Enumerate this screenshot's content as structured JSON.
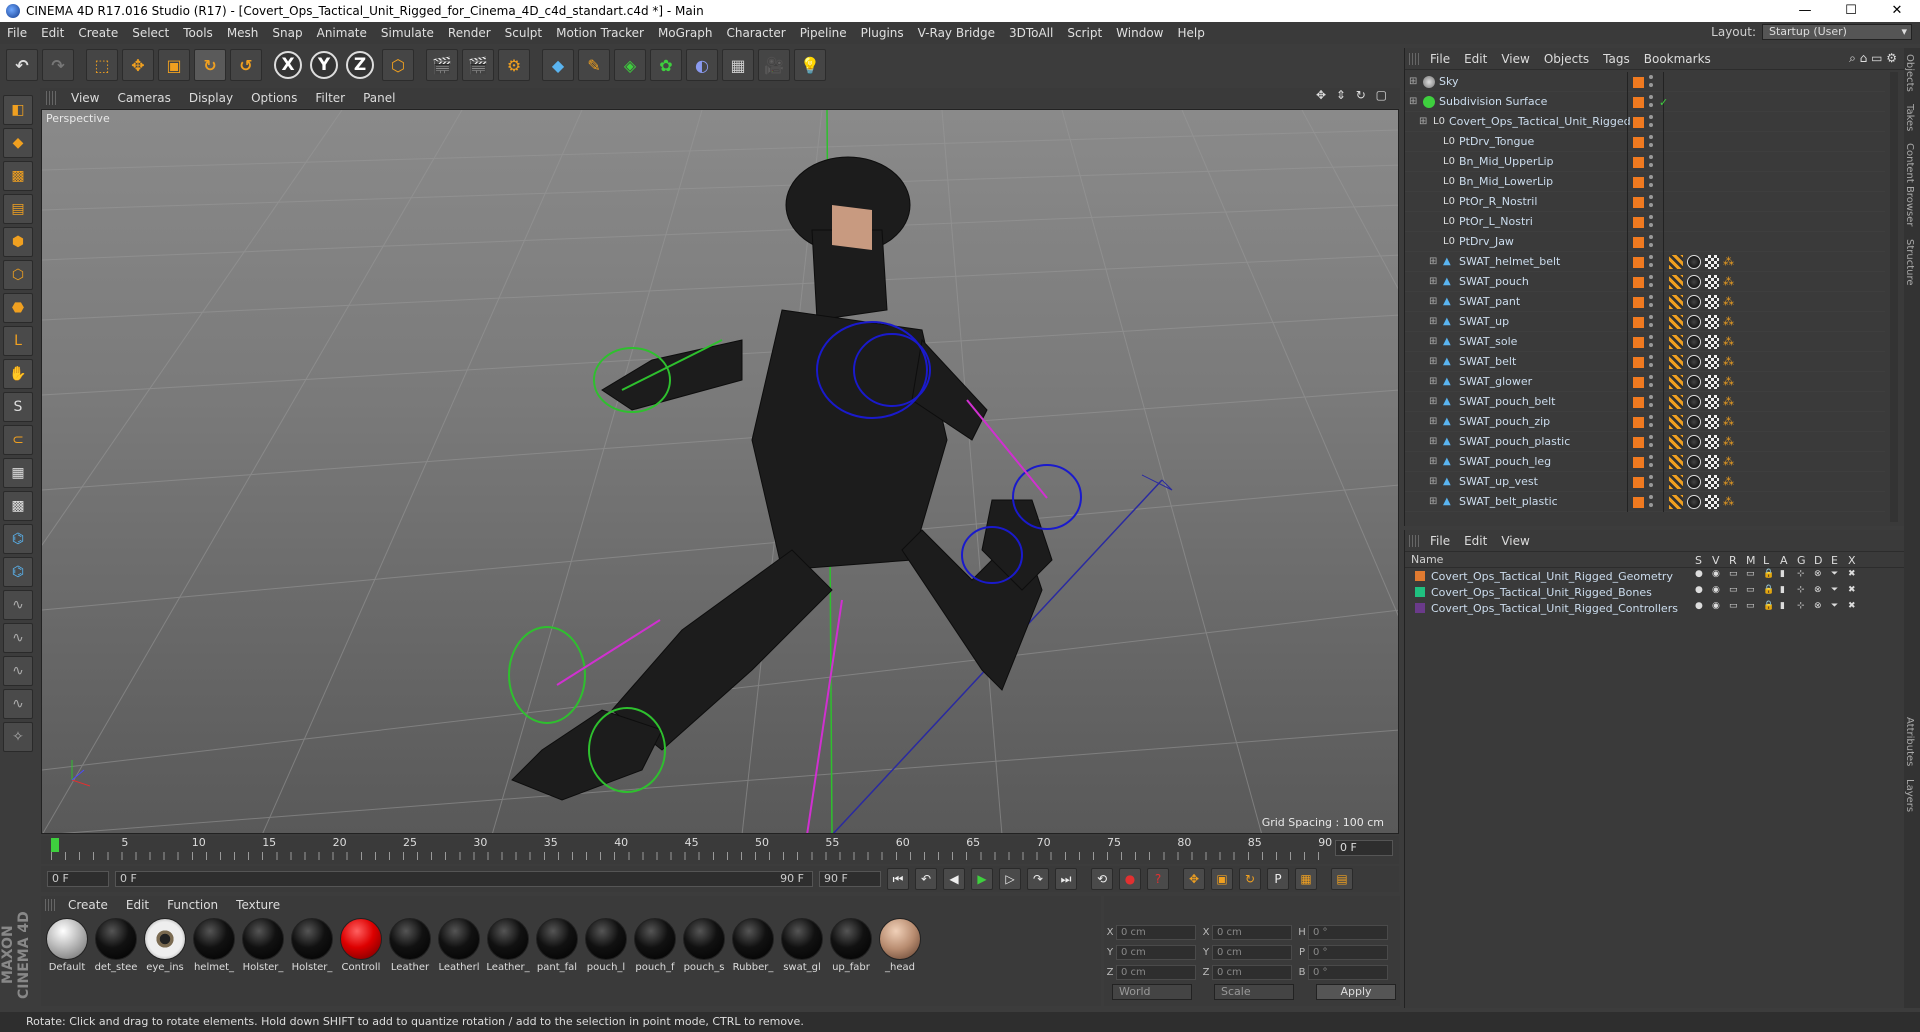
{
  "window": {
    "title": "CINEMA 4D R17.016 Studio (R17) - [Covert_Ops_Tactical_Unit_Rigged_for_Cinema_4D_c4d_standart.c4d *] - Main",
    "minimize": "—",
    "maximize": "☐",
    "close": "✕"
  },
  "menu": [
    "File",
    "Edit",
    "Create",
    "Select",
    "Tools",
    "Mesh",
    "Snap",
    "Animate",
    "Simulate",
    "Render",
    "Sculpt",
    "Motion Tracker",
    "MoGraph",
    "Character",
    "Pipeline",
    "Plugins",
    "V-Ray Bridge",
    "3DToAll",
    "Script",
    "Window",
    "Help"
  ],
  "layout": {
    "label": "Layout:",
    "value": "Startup (User)"
  },
  "toolbar": {
    "x_axis": "X",
    "y_axis": "Y",
    "z_axis": "Z"
  },
  "viewport": {
    "menu": [
      "View",
      "Cameras",
      "Display",
      "Options",
      "Filter",
      "Panel"
    ],
    "label": "Perspective",
    "grid_spacing": "Grid Spacing : 100 cm",
    "nav_icons": "✥ ⇕ ↻ ▢"
  },
  "timeline": {
    "ticks": [
      "0",
      "5",
      "10",
      "15",
      "20",
      "25",
      "30",
      "35",
      "40",
      "45",
      "50",
      "55",
      "60",
      "65",
      "70",
      "75",
      "80",
      "85",
      "90"
    ],
    "current": "0 F",
    "end": "0 F"
  },
  "transport": {
    "start_field": "0 F",
    "range_start": "0 F",
    "range_end": "90 F",
    "end_field": "90 F"
  },
  "materials": {
    "menu": [
      "Create",
      "Edit",
      "Function",
      "Texture"
    ],
    "items": [
      {
        "name": "Default",
        "kind": "default"
      },
      {
        "name": "det_stee",
        "kind": "black"
      },
      {
        "name": "eye_ins",
        "kind": "eye"
      },
      {
        "name": "helmet_",
        "kind": "black"
      },
      {
        "name": "Holster_",
        "kind": "black"
      },
      {
        "name": "Holster_",
        "kind": "black"
      },
      {
        "name": "Controll",
        "kind": "red"
      },
      {
        "name": "Leather",
        "kind": "black"
      },
      {
        "name": "Leatherl",
        "kind": "black"
      },
      {
        "name": "Leather_",
        "kind": "black"
      },
      {
        "name": "pant_fal",
        "kind": "black"
      },
      {
        "name": "pouch_l",
        "kind": "black"
      },
      {
        "name": "pouch_f",
        "kind": "black"
      },
      {
        "name": "pouch_s",
        "kind": "black"
      },
      {
        "name": "Rubber_",
        "kind": "black"
      },
      {
        "name": "swat_gl",
        "kind": "black"
      },
      {
        "name": "up_fabr",
        "kind": "black"
      },
      {
        "name": "_head",
        "kind": "skin"
      }
    ]
  },
  "coords": {
    "rows": [
      {
        "l1": "X",
        "v1": "0 cm",
        "l2": "X",
        "v2": "0 cm",
        "l3": "H",
        "v3": "0 °"
      },
      {
        "l1": "Y",
        "v1": "0 cm",
        "l2": "Y",
        "v2": "0 cm",
        "l3": "P",
        "v3": "0 °"
      },
      {
        "l1": "Z",
        "v1": "0 cm",
        "l2": "Z",
        "v2": "0 cm",
        "l3": "B",
        "v3": "0 °"
      }
    ],
    "space": "World",
    "mode": "Scale",
    "apply": "Apply"
  },
  "status": "Rotate: Click and drag to rotate elements. Hold down SHIFT to add to quantize rotation / add to the selection in point mode, CTRL to remove.",
  "maxon": "MAXON CINEMA 4D",
  "objects": {
    "menu": [
      "File",
      "Edit",
      "View",
      "Objects",
      "Tags",
      "Bookmarks"
    ],
    "rows": [
      {
        "name": "Sky",
        "indent": 0,
        "icon": "sky",
        "tags": false
      },
      {
        "name": "Subdivision Surface",
        "indent": 0,
        "icon": "subd",
        "tags": false
      },
      {
        "name": "Covert_Ops_Tactical_Unit_Rigged",
        "indent": 1,
        "icon": "null",
        "tags": false
      },
      {
        "name": "PtDrv_Tongue",
        "indent": 2,
        "icon": "null",
        "tags": false
      },
      {
        "name": "Bn_Mid_UpperLip",
        "indent": 2,
        "icon": "null",
        "tags": false
      },
      {
        "name": "Bn_Mid_LowerLip",
        "indent": 2,
        "icon": "null",
        "tags": false
      },
      {
        "name": "PtOr_R_Nostril",
        "indent": 2,
        "icon": "null",
        "tags": false
      },
      {
        "name": "PtOr_L_Nostri",
        "indent": 2,
        "icon": "null",
        "tags": false
      },
      {
        "name": "PtDrv_Jaw",
        "indent": 2,
        "icon": "null",
        "tags": false
      },
      {
        "name": "SWAT_helmet_belt",
        "indent": 2,
        "icon": "mesh",
        "tags": true
      },
      {
        "name": "SWAT_pouch",
        "indent": 2,
        "icon": "mesh",
        "tags": true
      },
      {
        "name": "SWAT_pant",
        "indent": 2,
        "icon": "mesh",
        "tags": true
      },
      {
        "name": "SWAT_up",
        "indent": 2,
        "icon": "mesh",
        "tags": true
      },
      {
        "name": "SWAT_sole",
        "indent": 2,
        "icon": "mesh",
        "tags": true
      },
      {
        "name": "SWAT_belt",
        "indent": 2,
        "icon": "mesh",
        "tags": true
      },
      {
        "name": "SWAT_glower",
        "indent": 2,
        "icon": "mesh",
        "tags": true
      },
      {
        "name": "SWAT_pouch_belt",
        "indent": 2,
        "icon": "mesh",
        "tags": true
      },
      {
        "name": "SWAT_pouch_zip",
        "indent": 2,
        "icon": "mesh",
        "tags": true
      },
      {
        "name": "SWAT_pouch_plastic",
        "indent": 2,
        "icon": "mesh",
        "tags": true
      },
      {
        "name": "SWAT_pouch_leg",
        "indent": 2,
        "icon": "mesh",
        "tags": true
      },
      {
        "name": "SWAT_up_vest",
        "indent": 2,
        "icon": "mesh",
        "tags": true
      },
      {
        "name": "SWAT_belt_plastic",
        "indent": 2,
        "icon": "mesh",
        "tags": true
      }
    ]
  },
  "layers": {
    "menu": [
      "File",
      "Edit",
      "View"
    ],
    "header": {
      "name": "Name",
      "cols": [
        "S",
        "V",
        "R",
        "M",
        "L",
        "A",
        "G",
        "D",
        "E",
        "X"
      ]
    },
    "rows": [
      {
        "name": "Covert_Ops_Tactical_Unit_Rigged_Geometry",
        "color": "#e07a30"
      },
      {
        "name": "Covert_Ops_Tactical_Unit_Rigged_Bones",
        "color": "#20c080"
      },
      {
        "name": "Covert_Ops_Tactical_Unit_Rigged_Controllers",
        "color": "#6a3a8a"
      }
    ]
  },
  "right_tabs": [
    "Objects",
    "Takes",
    "Content Browser",
    "Structure",
    "Attributes",
    "Layers"
  ]
}
